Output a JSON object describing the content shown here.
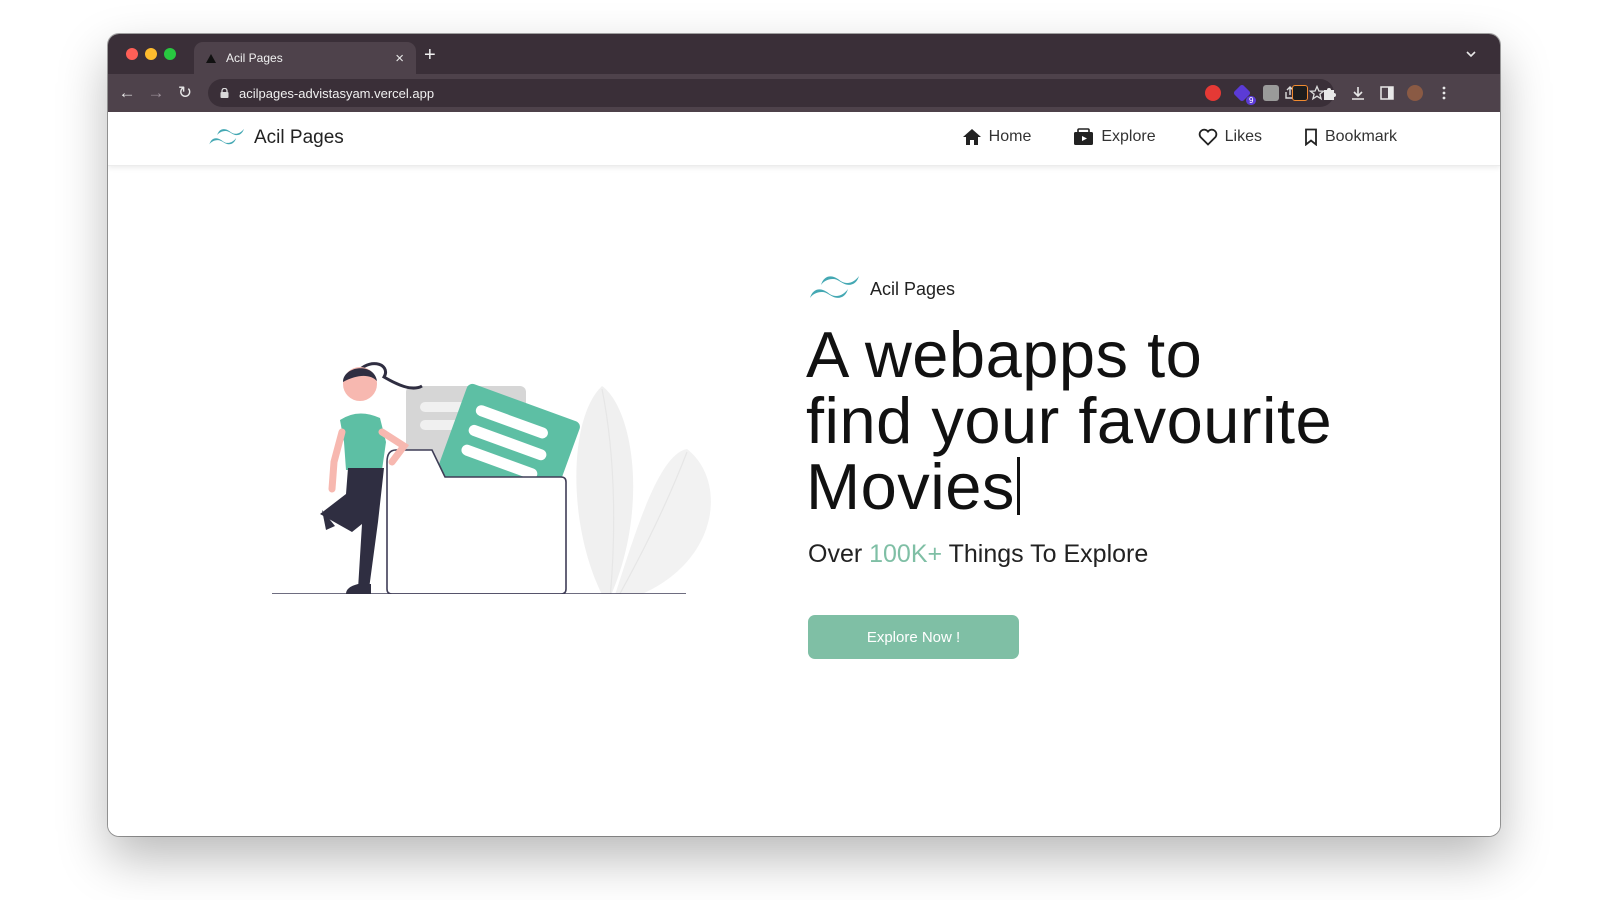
{
  "browser": {
    "tab_title": "Acil Pages",
    "url": "acilpages-advistasyam.vercel.app",
    "extension_badge": "9"
  },
  "site": {
    "brand_name": "Acil Pages",
    "nav": [
      {
        "label": "Home",
        "icon": "home-icon"
      },
      {
        "label": "Explore",
        "icon": "explore-icon"
      },
      {
        "label": "Likes",
        "icon": "heart-icon"
      },
      {
        "label": "Bookmark",
        "icon": "bookmark-icon"
      }
    ]
  },
  "hero": {
    "brand_name": "Acil Pages",
    "headline_line1": "A webapps to",
    "headline_line2": "find your favourite",
    "headline_line3": "Movies",
    "subhead_before": "Over ",
    "subhead_accent": "100K+",
    "subhead_after": " Things To Explore",
    "cta_label": "Explore Now !"
  },
  "colors": {
    "accent": "#7fbfa5",
    "logo_teal": "#44a8b3",
    "tab_strip": "#3a2f38",
    "toolbar": "#4e424b"
  }
}
